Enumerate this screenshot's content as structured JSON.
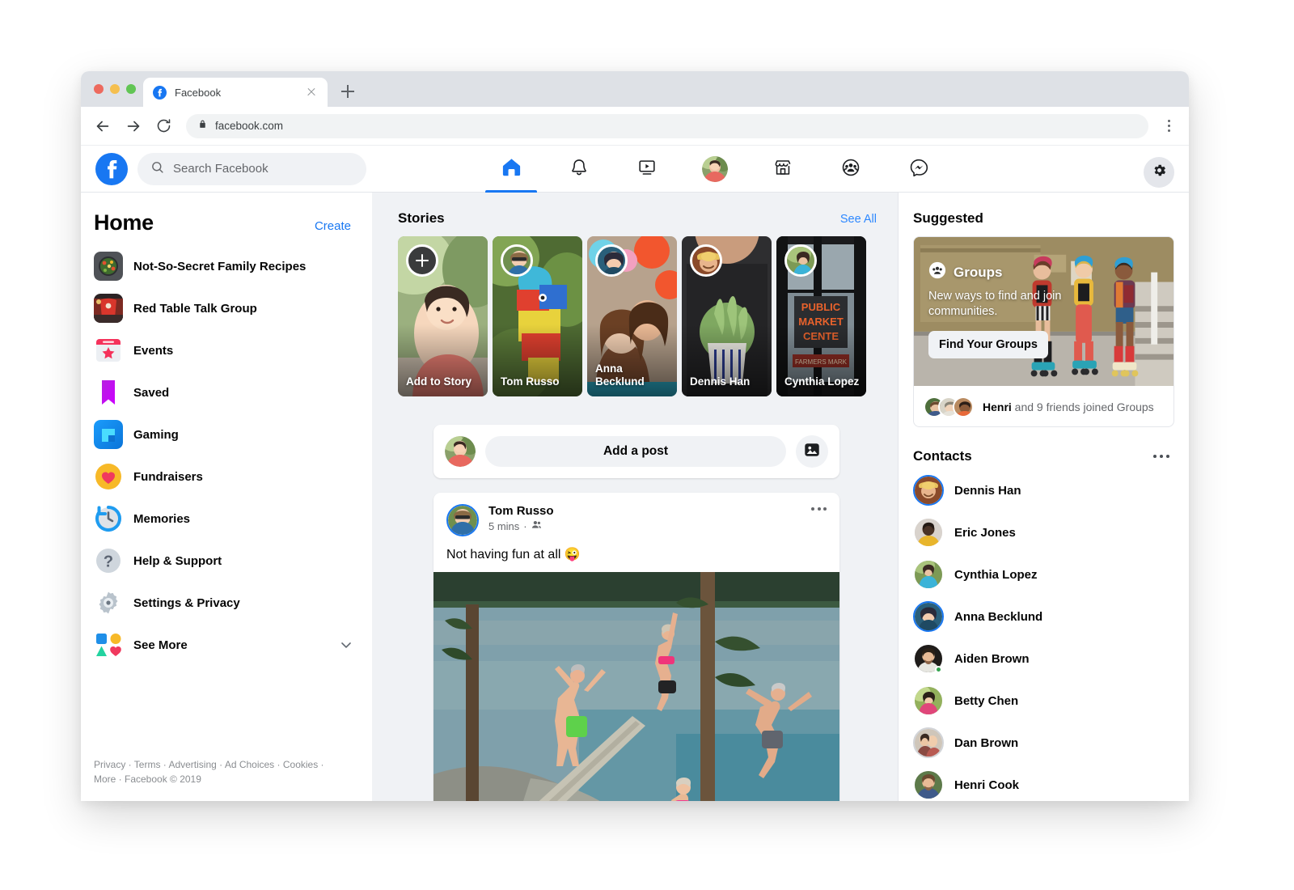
{
  "browser": {
    "tab_title": "Facebook",
    "url": "facebook.com",
    "new_tab_label": "+",
    "back_label": "Back",
    "forward_label": "Forward",
    "reload_label": "Reload",
    "menu_label": "Browser menu"
  },
  "topbar": {
    "search_placeholder": "Search Facebook",
    "nav": [
      {
        "name": "home",
        "label": "Home",
        "active": true
      },
      {
        "name": "notifications",
        "label": "Notifications",
        "active": false
      },
      {
        "name": "watch",
        "label": "Watch",
        "active": false
      },
      {
        "name": "profile",
        "label": "Profile",
        "active": false
      },
      {
        "name": "marketplace",
        "label": "Marketplace",
        "active": false
      },
      {
        "name": "groups",
        "label": "Groups",
        "active": false
      },
      {
        "name": "messenger",
        "label": "Messenger",
        "active": false
      }
    ],
    "settings_label": "Settings"
  },
  "sidebar": {
    "title": "Home",
    "create_label": "Create",
    "items": [
      {
        "label": "Not-So-Secret Family Recipes",
        "icon": "recipes-photo-icon"
      },
      {
        "label": "Red Table Talk Group",
        "icon": "red-table-talk-photo-icon"
      },
      {
        "label": "Events",
        "icon": "calendar-star-icon"
      },
      {
        "label": "Saved",
        "icon": "bookmark-icon"
      },
      {
        "label": "Gaming",
        "icon": "gaming-icon"
      },
      {
        "label": "Fundraisers",
        "icon": "heart-circle-icon"
      },
      {
        "label": "Memories",
        "icon": "clock-history-icon"
      },
      {
        "label": "Help & Support",
        "icon": "question-circle-icon"
      },
      {
        "label": "Settings & Privacy",
        "icon": "gear-icon"
      },
      {
        "label": "See More",
        "icon": "shapes-icon"
      }
    ],
    "footer_line1": "Privacy · Terms · Advertising · Ad Choices · Cookies ·",
    "footer_line2": "More · Facebook © 2019"
  },
  "stories": {
    "title": "Stories",
    "see_all_label": "See All",
    "cards": [
      {
        "name": "Add to Story",
        "type": "add"
      },
      {
        "name": "Tom Russo",
        "type": "story",
        "ring": "white"
      },
      {
        "name": "Anna Becklund",
        "type": "story",
        "ring": "white"
      },
      {
        "name": "Dennis Han",
        "type": "story",
        "ring": "white"
      },
      {
        "name": "Cynthia Lopez",
        "type": "story",
        "ring": "white"
      }
    ]
  },
  "composer": {
    "placeholder": "Add a post",
    "photo_button_label": "Photo"
  },
  "post": {
    "author": "Tom Russo",
    "time": "5 mins",
    "audience_icon": "friends-icon",
    "text": "Not having fun at all 😜",
    "menu_label": "More options"
  },
  "right": {
    "suggested_title": "Suggested",
    "card": {
      "badge_label": "Groups",
      "description": "New ways to find and join communities.",
      "button_label": "Find Your Groups",
      "footer_bold": "Henri",
      "footer_rest": " and 9 friends joined Groups"
    },
    "contacts_title": "Contacts",
    "contacts_menu_label": "Contacts options",
    "contacts": [
      {
        "name": "Dennis Han",
        "ring": "blue",
        "online": false
      },
      {
        "name": "Eric Jones",
        "ring": "none",
        "online": false
      },
      {
        "name": "Cynthia Lopez",
        "ring": "none",
        "online": false
      },
      {
        "name": "Anna Becklund",
        "ring": "blue",
        "online": false
      },
      {
        "name": "Aiden Brown",
        "ring": "none",
        "online": true
      },
      {
        "name": "Betty Chen",
        "ring": "none",
        "online": false
      },
      {
        "name": "Dan Brown",
        "ring": "gray",
        "online": false
      },
      {
        "name": "Henri Cook",
        "ring": "none",
        "online": false
      }
    ]
  },
  "colors": {
    "brand_blue": "#1877f2",
    "link_blue": "#2d88ff",
    "app_bg": "#f0f2f5",
    "text_primary": "#050505",
    "text_secondary": "#65676b",
    "online_green": "#31a24c"
  }
}
